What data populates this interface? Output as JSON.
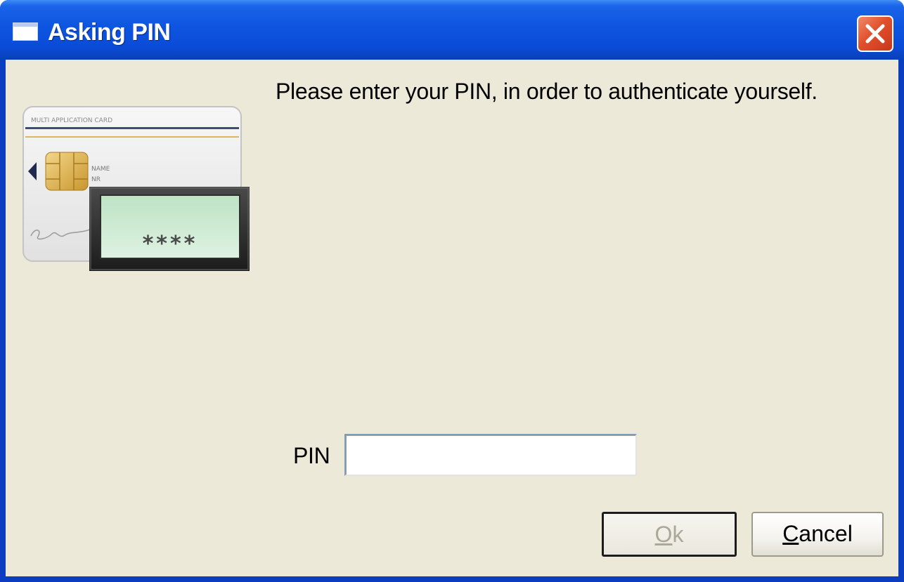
{
  "window": {
    "title": "Asking PIN",
    "title_color": "#ffffff",
    "titlebar_color": "#0a55e0",
    "client_color": "#ece9d8"
  },
  "card": {
    "header_text": "MULTI APPLICATION CARD",
    "name_label": "NAME",
    "nr_label": "NR",
    "pin_mask": "****"
  },
  "prompt": {
    "message": "Please enter your PIN, in order to authenticate yourself."
  },
  "form": {
    "pin_label": "PIN",
    "pin_value": ""
  },
  "buttons": {
    "ok_first": "O",
    "ok_rest": "k",
    "ok_enabled": false,
    "cancel_first": "C",
    "cancel_rest": "ancel"
  },
  "icons": {
    "window_icon": "window-icon",
    "close": "close-icon"
  }
}
